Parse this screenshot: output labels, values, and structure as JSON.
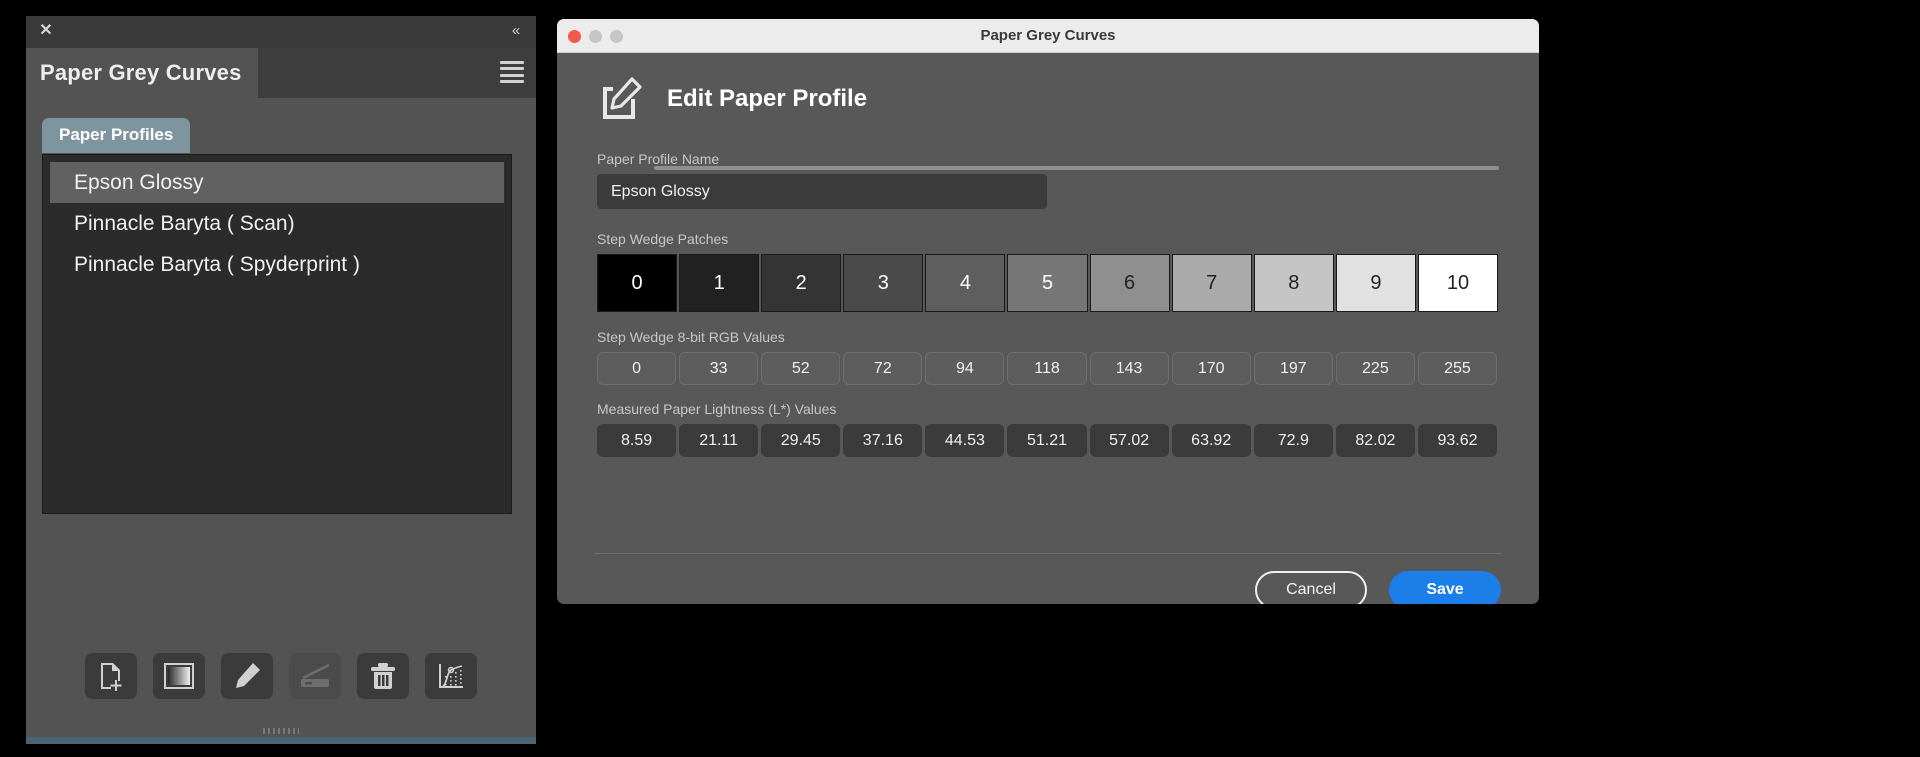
{
  "panel": {
    "title": "Paper Grey Curves",
    "close_icon": "close-icon",
    "collapse_icon": "collapse-left-icon",
    "menu_icon": "hamburger-menu-icon",
    "tab": {
      "label": "Paper Profiles"
    },
    "profiles": [
      {
        "label": "Epson Glossy",
        "selected": true
      },
      {
        "label": "Pinnacle Baryta ( Scan)",
        "selected": false
      },
      {
        "label": "Pinnacle Baryta ( Spyderprint )",
        "selected": false
      }
    ],
    "tools": [
      {
        "name": "new-profile-icon",
        "title": "New Profile",
        "disabled": false
      },
      {
        "name": "step-wedge-icon",
        "title": "Step Wedge",
        "disabled": false
      },
      {
        "name": "edit-pencil-icon",
        "title": "Edit Profile",
        "disabled": false
      },
      {
        "name": "scanner-icon",
        "title": "Scan",
        "disabled": true
      },
      {
        "name": "trash-icon",
        "title": "Delete Profile",
        "disabled": false
      },
      {
        "name": "curve-chart-icon",
        "title": "Curve Chart",
        "disabled": false
      }
    ]
  },
  "dialog": {
    "window_title": "Paper Grey Curves",
    "traffic_lights": [
      {
        "name": "close",
        "color": "#f0594c"
      },
      {
        "name": "minimize",
        "color": "#c6c6c6"
      },
      {
        "name": "zoom",
        "color": "#c6c6c6"
      }
    ],
    "heading": "Edit Paper Profile",
    "heading_icon": "edit-document-pencil-icon",
    "name_field": {
      "label": "Paper Profile Name",
      "value": "Epson Glossy",
      "placeholder": "Paper Profile Name"
    },
    "patches": {
      "label": "Step Wedge Patches",
      "indices": [
        "0",
        "1",
        "2",
        "3",
        "4",
        "5",
        "6",
        "7",
        "8",
        "9",
        "10"
      ],
      "colors": [
        "#000000",
        "#212121",
        "#343434",
        "#4a4a4a",
        "#5e5e5e",
        "#767676",
        "#8f8f8f",
        "#aaaaaa",
        "#c5c5c5",
        "#e1e1e1",
        "#ffffff"
      ],
      "text_colors": [
        "#ffffff",
        "#ffffff",
        "#ffffff",
        "#ffffff",
        "#ffffff",
        "#ffffff",
        "#222222",
        "#222222",
        "#222222",
        "#222222",
        "#222222"
      ]
    },
    "rgb": {
      "label": "Step Wedge 8-bit RGB Values",
      "values": [
        "0",
        "33",
        "52",
        "72",
        "94",
        "118",
        "143",
        "170",
        "197",
        "225",
        "255"
      ]
    },
    "lab": {
      "label": "Measured Paper Lightness (L*) Values",
      "values": [
        "8.59",
        "21.11",
        "29.45",
        "37.16",
        "44.53",
        "51.21",
        "57.02",
        "63.92",
        "72.9",
        "82.02",
        "93.62"
      ]
    },
    "cancel_label": "Cancel",
    "save_label": "Save",
    "accent_color": "#1c7ee8"
  }
}
